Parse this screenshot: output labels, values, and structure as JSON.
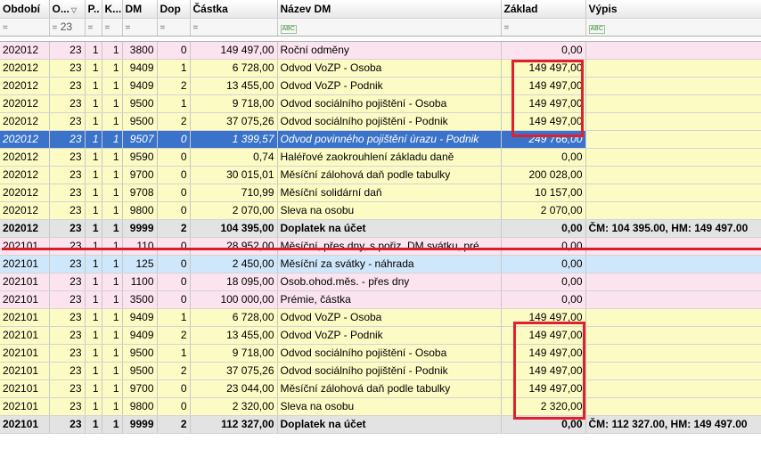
{
  "columns": [
    {
      "label": "Období"
    },
    {
      "label": "O..."
    },
    {
      "label": "P.."
    },
    {
      "label": "K..."
    },
    {
      "label": "DM"
    },
    {
      "label": "Dop"
    },
    {
      "label": "Částka"
    },
    {
      "label": "Název DM"
    },
    {
      "label": "Základ"
    },
    {
      "label": "Výpis"
    }
  ],
  "filter": {
    "eq": "=",
    "o_value": "23",
    "abc": "ABC"
  },
  "rows": [
    {
      "style": "pink",
      "obdobi": "202012",
      "o": "23",
      "p": "1",
      "k": "1",
      "dm": "3800",
      "dop": "0",
      "castka": "149 497,00",
      "nazev": "Roční odměny",
      "zaklad": "0,00",
      "vypis": ""
    },
    {
      "style": "yellow",
      "obdobi": "202012",
      "o": "23",
      "p": "1",
      "k": "1",
      "dm": "9409",
      "dop": "1",
      "castka": "6 728,00",
      "nazev": "Odvod VoZP - Osoba",
      "zaklad": "149 497,00",
      "vypis": ""
    },
    {
      "style": "yellow",
      "obdobi": "202012",
      "o": "23",
      "p": "1",
      "k": "1",
      "dm": "9409",
      "dop": "2",
      "castka": "13 455,00",
      "nazev": "Odvod VoZP - Podnik",
      "zaklad": "149 497,00",
      "vypis": ""
    },
    {
      "style": "yellow",
      "obdobi": "202012",
      "o": "23",
      "p": "1",
      "k": "1",
      "dm": "9500",
      "dop": "1",
      "castka": "9 718,00",
      "nazev": "Odvod sociálního pojištění - Osoba",
      "zaklad": "149 497,00",
      "vypis": ""
    },
    {
      "style": "yellow",
      "obdobi": "202012",
      "o": "23",
      "p": "1",
      "k": "1",
      "dm": "9500",
      "dop": "2",
      "castka": "37 075,26",
      "nazev": "Odvod sociálního pojištění - Podnik",
      "zaklad": "149 497,00",
      "vypis": ""
    },
    {
      "style": "sel",
      "obdobi": "202012",
      "o": "23",
      "p": "1",
      "k": "1",
      "dm": "9507",
      "dop": "0",
      "castka": "1 399,57",
      "nazev": "Odvod povinného pojištění úrazu - Podnik",
      "zaklad": "249 766,00",
      "vypis": ""
    },
    {
      "style": "yellow",
      "obdobi": "202012",
      "o": "23",
      "p": "1",
      "k": "1",
      "dm": "9590",
      "dop": "0",
      "castka": "0,74",
      "nazev": "Haléřové zaokrouhlení základu daně",
      "zaklad": "0,00",
      "vypis": ""
    },
    {
      "style": "yellow",
      "obdobi": "202012",
      "o": "23",
      "p": "1",
      "k": "1",
      "dm": "9700",
      "dop": "0",
      "castka": "30 015,01",
      "nazev": "Měsíční zálohová daň podle tabulky",
      "zaklad": "200 028,00",
      "vypis": ""
    },
    {
      "style": "yellow",
      "obdobi": "202012",
      "o": "23",
      "p": "1",
      "k": "1",
      "dm": "9708",
      "dop": "0",
      "castka": "710,99",
      "nazev": "Měsíční solidární daň",
      "zaklad": "10 157,00",
      "vypis": ""
    },
    {
      "style": "yellow",
      "obdobi": "202012",
      "o": "23",
      "p": "1",
      "k": "1",
      "dm": "9800",
      "dop": "0",
      "castka": "2 070,00",
      "nazev": "Sleva na osobu",
      "zaklad": "2 070,00",
      "vypis": ""
    },
    {
      "style": "gray",
      "obdobi": "202012",
      "o": "23",
      "p": "1",
      "k": "1",
      "dm": "9999",
      "dop": "2",
      "castka": "104 395,00",
      "nazev": "Doplatek na účet",
      "zaklad": "0,00",
      "vypis": "ČM: 104 395.00, HM: 149 497.00"
    },
    {
      "style": "pink",
      "obdobi": "202101",
      "o": "23",
      "p": "1",
      "k": "1",
      "dm": "110",
      "dop": "0",
      "castka": "28 952,00",
      "nazev": "Měsíční, přes dny, s pořiz. DM svátku, pré",
      "zaklad": "0,00",
      "vypis": ""
    },
    {
      "style": "blue",
      "obdobi": "202101",
      "o": "23",
      "p": "1",
      "k": "1",
      "dm": "125",
      "dop": "0",
      "castka": "2 450,00",
      "nazev": "Měsíční za svátky - náhrada",
      "zaklad": "0,00",
      "vypis": ""
    },
    {
      "style": "pink",
      "obdobi": "202101",
      "o": "23",
      "p": "1",
      "k": "1",
      "dm": "1100",
      "dop": "0",
      "castka": "18 095,00",
      "nazev": "Osob.ohod.měs. - přes dny",
      "zaklad": "0,00",
      "vypis": ""
    },
    {
      "style": "pink",
      "obdobi": "202101",
      "o": "23",
      "p": "1",
      "k": "1",
      "dm": "3500",
      "dop": "0",
      "castka": "100 000,00",
      "nazev": "Prémie, částka",
      "zaklad": "0,00",
      "vypis": ""
    },
    {
      "style": "yellow",
      "obdobi": "202101",
      "o": "23",
      "p": "1",
      "k": "1",
      "dm": "9409",
      "dop": "1",
      "castka": "6 728,00",
      "nazev": "Odvod VoZP - Osoba",
      "zaklad": "149 497,00",
      "vypis": ""
    },
    {
      "style": "yellow",
      "obdobi": "202101",
      "o": "23",
      "p": "1",
      "k": "1",
      "dm": "9409",
      "dop": "2",
      "castka": "13 455,00",
      "nazev": "Odvod VoZP - Podnik",
      "zaklad": "149 497,00",
      "vypis": ""
    },
    {
      "style": "yellow",
      "obdobi": "202101",
      "o": "23",
      "p": "1",
      "k": "1",
      "dm": "9500",
      "dop": "1",
      "castka": "9 718,00",
      "nazev": "Odvod sociálního pojištění - Osoba",
      "zaklad": "149 497,00",
      "vypis": ""
    },
    {
      "style": "yellow",
      "obdobi": "202101",
      "o": "23",
      "p": "1",
      "k": "1",
      "dm": "9500",
      "dop": "2",
      "castka": "37 075,26",
      "nazev": "Odvod sociálního pojištění - Podnik",
      "zaklad": "149 497,00",
      "vypis": ""
    },
    {
      "style": "yellow",
      "obdobi": "202101",
      "o": "23",
      "p": "1",
      "k": "1",
      "dm": "9700",
      "dop": "0",
      "castka": "23 044,00",
      "nazev": "Měsíční zálohová daň podle tabulky",
      "zaklad": "149 497,00",
      "vypis": ""
    },
    {
      "style": "yellow",
      "obdobi": "202101",
      "o": "23",
      "p": "1",
      "k": "1",
      "dm": "9800",
      "dop": "0",
      "castka": "2 320,00",
      "nazev": "Sleva na osobu",
      "zaklad": "2 320,00",
      "vypis": ""
    },
    {
      "style": "gray",
      "obdobi": "202101",
      "o": "23",
      "p": "1",
      "k": "1",
      "dm": "9999",
      "dop": "2",
      "castka": "112 327,00",
      "nazev": "Doplatek na účet",
      "zaklad": "0,00",
      "vypis": "ČM: 112 327.00, HM: 149 497.00"
    }
  ],
  "colors": {
    "highlight_red": "#e0202a",
    "selected_row": "#3a73c9",
    "pink_row": "#fbe3ef",
    "yellow_row": "#fdfbc4",
    "total_row": "#e3e3e3",
    "blue_row": "#cfe7fb"
  }
}
